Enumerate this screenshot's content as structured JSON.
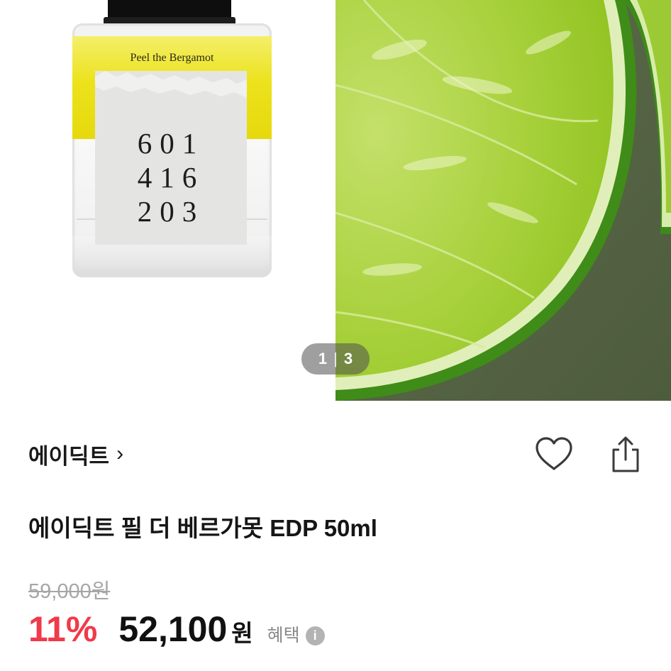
{
  "gallery": {
    "current": "1",
    "separator": "|",
    "total": "3",
    "bottle_name": "Peel the Bergamot",
    "label_code": [
      "601",
      "416",
      "203"
    ]
  },
  "product": {
    "brand": "에이딕트",
    "brand_chevron": "›",
    "title": "에이딕트 필 더 베르가못 EDP 50ml"
  },
  "price": {
    "original": "59,000원",
    "discount": "11%",
    "sale": "52,100",
    "currency": "원",
    "benefit_label": "혜택",
    "info_glyph": "i"
  },
  "colors": {
    "discount_red": "#f03a4a",
    "strike_gray": "#a6a6a6",
    "lime_green": "#8fc21f"
  },
  "icons": [
    "heart-icon",
    "share-icon",
    "chevron-right-icon",
    "info-icon"
  ]
}
